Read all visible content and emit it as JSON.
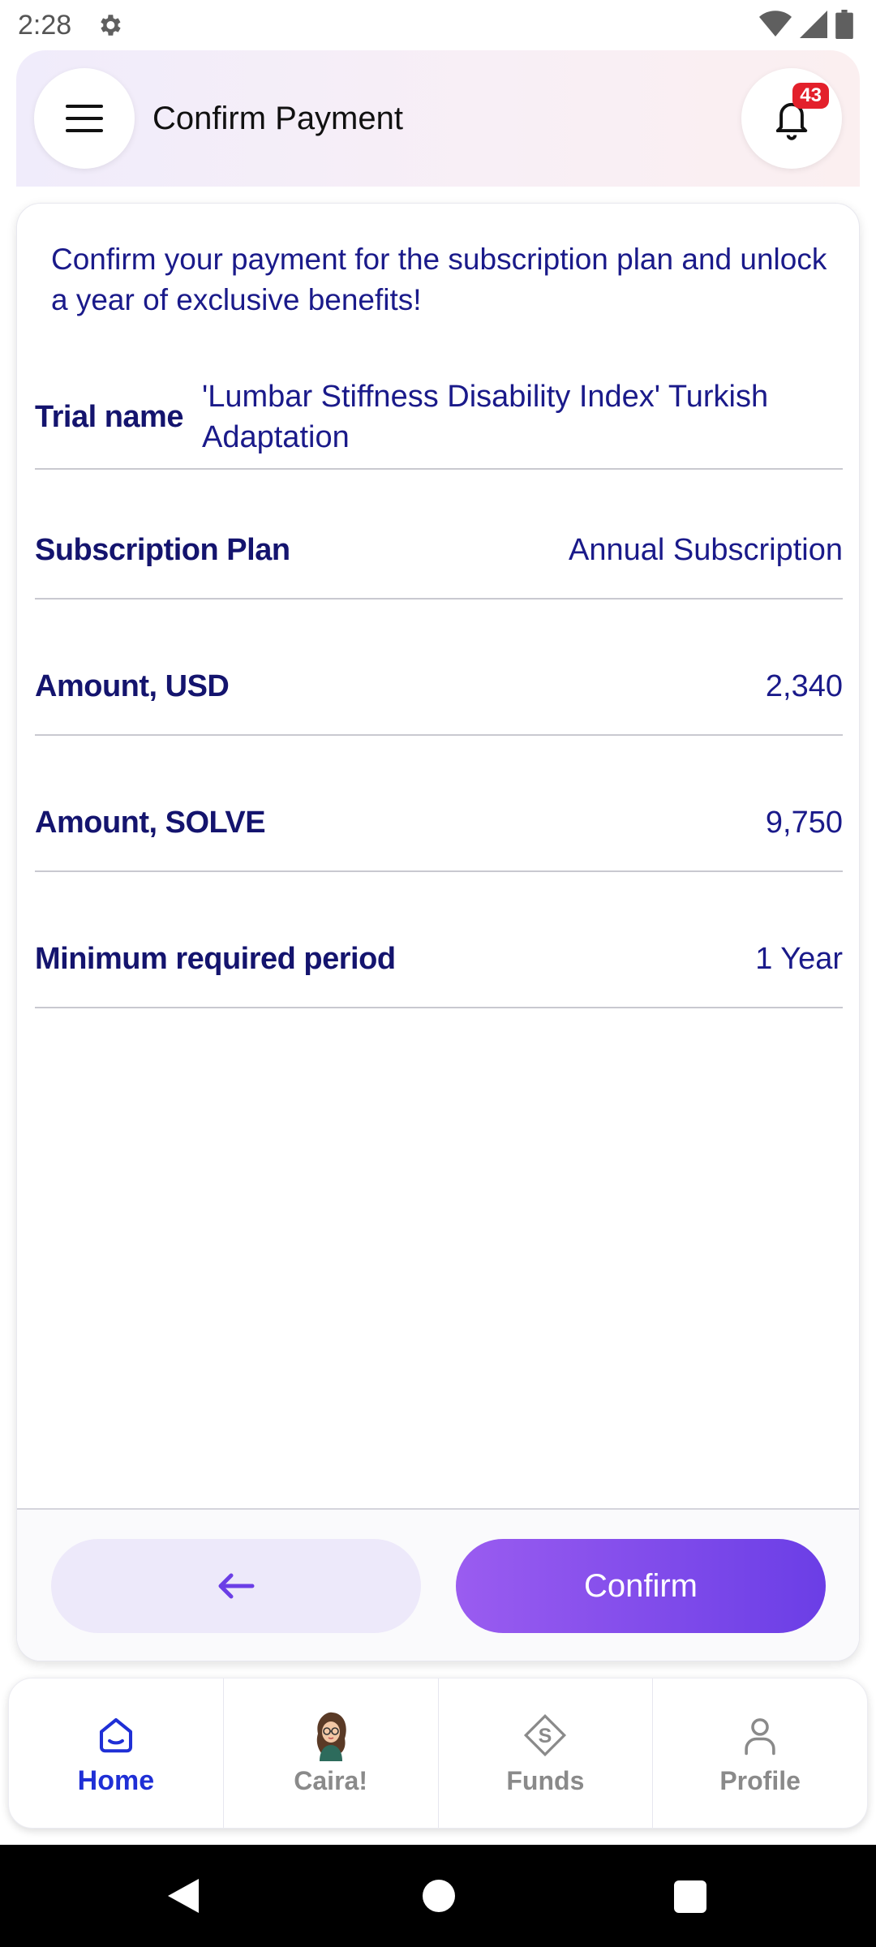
{
  "status_bar": {
    "time": "2:28"
  },
  "header": {
    "title": "Confirm Payment",
    "notification_count": "43"
  },
  "card": {
    "intro": "Confirm your payment for the subscription plan and unlock a year of exclusive benefits!",
    "rows": [
      {
        "label": "Trial name",
        "value": "'Lumbar Stiffness Disability Index' Turkish Adaptation"
      },
      {
        "label": "Subscription Plan",
        "value": "Annual Subscription"
      },
      {
        "label": "Amount, USD",
        "value": "2,340"
      },
      {
        "label": "Amount, SOLVE",
        "value": "9,750"
      },
      {
        "label": "Minimum required period",
        "value": "1 Year"
      }
    ],
    "confirm_label": "Confirm"
  },
  "bottom_nav": [
    {
      "label": "Home",
      "icon": "home-icon",
      "active": true
    },
    {
      "label": "Caira!",
      "icon": "caira-avatar-icon",
      "active": false
    },
    {
      "label": "Funds",
      "icon": "funds-icon",
      "active": false
    },
    {
      "label": "Profile",
      "icon": "profile-icon",
      "active": false
    }
  ],
  "colors": {
    "accent": "#6b3ee6",
    "active_nav": "#1f2fd6",
    "badge": "#e3202b",
    "text": "#1a1a8a"
  }
}
